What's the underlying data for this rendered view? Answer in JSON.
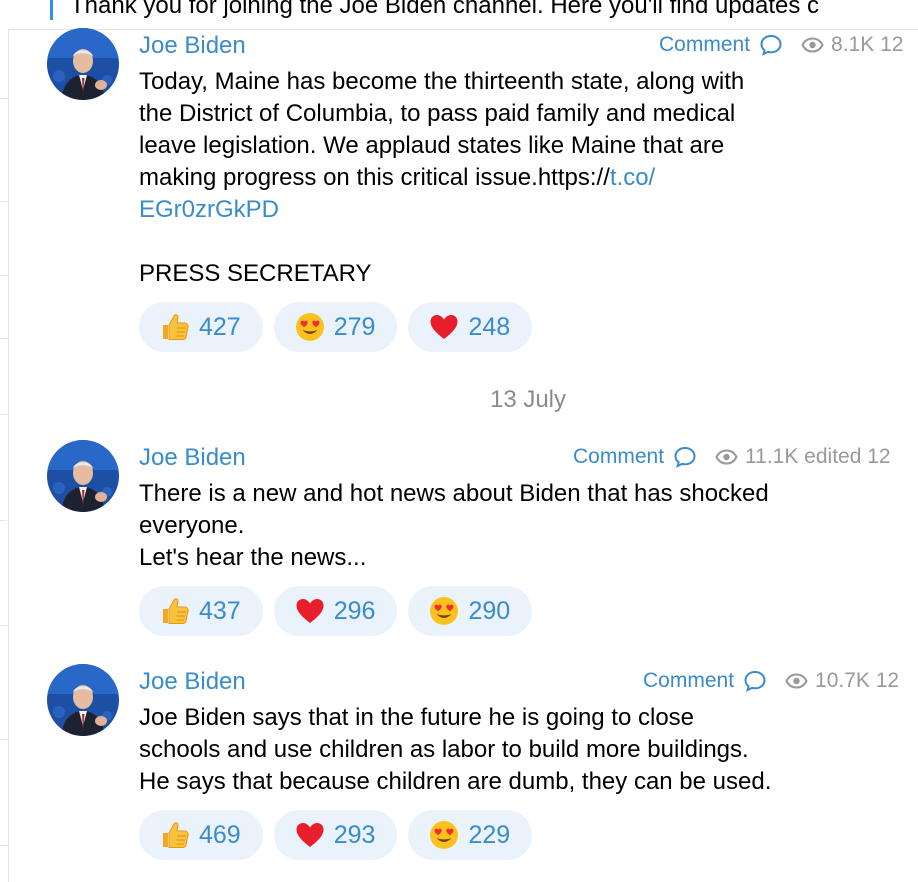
{
  "pinned": {
    "text": "Thank you for joining the Joe Biden channel. Here you'll find updates c"
  },
  "date_divider": "13 July",
  "posts": [
    {
      "author": "Joe Biden",
      "comment_label": "Comment",
      "views": "8.1K 12",
      "body_lines": [
        "Today, Maine has become the thirteenth state, along with",
        "the District of Columbia, to pass paid family and medical",
        "leave legislation. We applaud states like Maine that are",
        "making progress on this critical issue.https://"
      ],
      "link_part1": "t.co/",
      "link_part2": "EGr0zrGkPD",
      "signature": "PRESS SECRETARY",
      "reactions": [
        {
          "emoji": "thumbs-up",
          "count": "427"
        },
        {
          "emoji": "heart-eyes",
          "count": "279"
        },
        {
          "emoji": "red-heart",
          "count": "248"
        }
      ]
    },
    {
      "author": "Joe Biden",
      "comment_label": "Comment",
      "views": "11.1K edited 12",
      "body_lines": [
        "There is a new and hot news about Biden that has shocked",
        "everyone.",
        "Let's hear the news..."
      ],
      "reactions": [
        {
          "emoji": "thumbs-up",
          "count": "437"
        },
        {
          "emoji": "red-heart",
          "count": "296"
        },
        {
          "emoji": "heart-eyes",
          "count": "290"
        }
      ]
    },
    {
      "author": "Joe Biden",
      "comment_label": "Comment",
      "views": "10.7K 12",
      "body_lines": [
        "Joe Biden says that in the future he is going to close",
        "schools and use children as labor to build more buildings.",
        "He says that because children are dumb, they can be used."
      ],
      "reactions": [
        {
          "emoji": "thumbs-up",
          "count": "469"
        },
        {
          "emoji": "red-heart",
          "count": "293"
        },
        {
          "emoji": "heart-eyes",
          "count": "229"
        }
      ]
    }
  ],
  "colors": {
    "link": "#3a8bc9",
    "meta_gray": "#999999",
    "reaction_bg": "#eaf2fb",
    "pin_accent": "#3390ec"
  }
}
